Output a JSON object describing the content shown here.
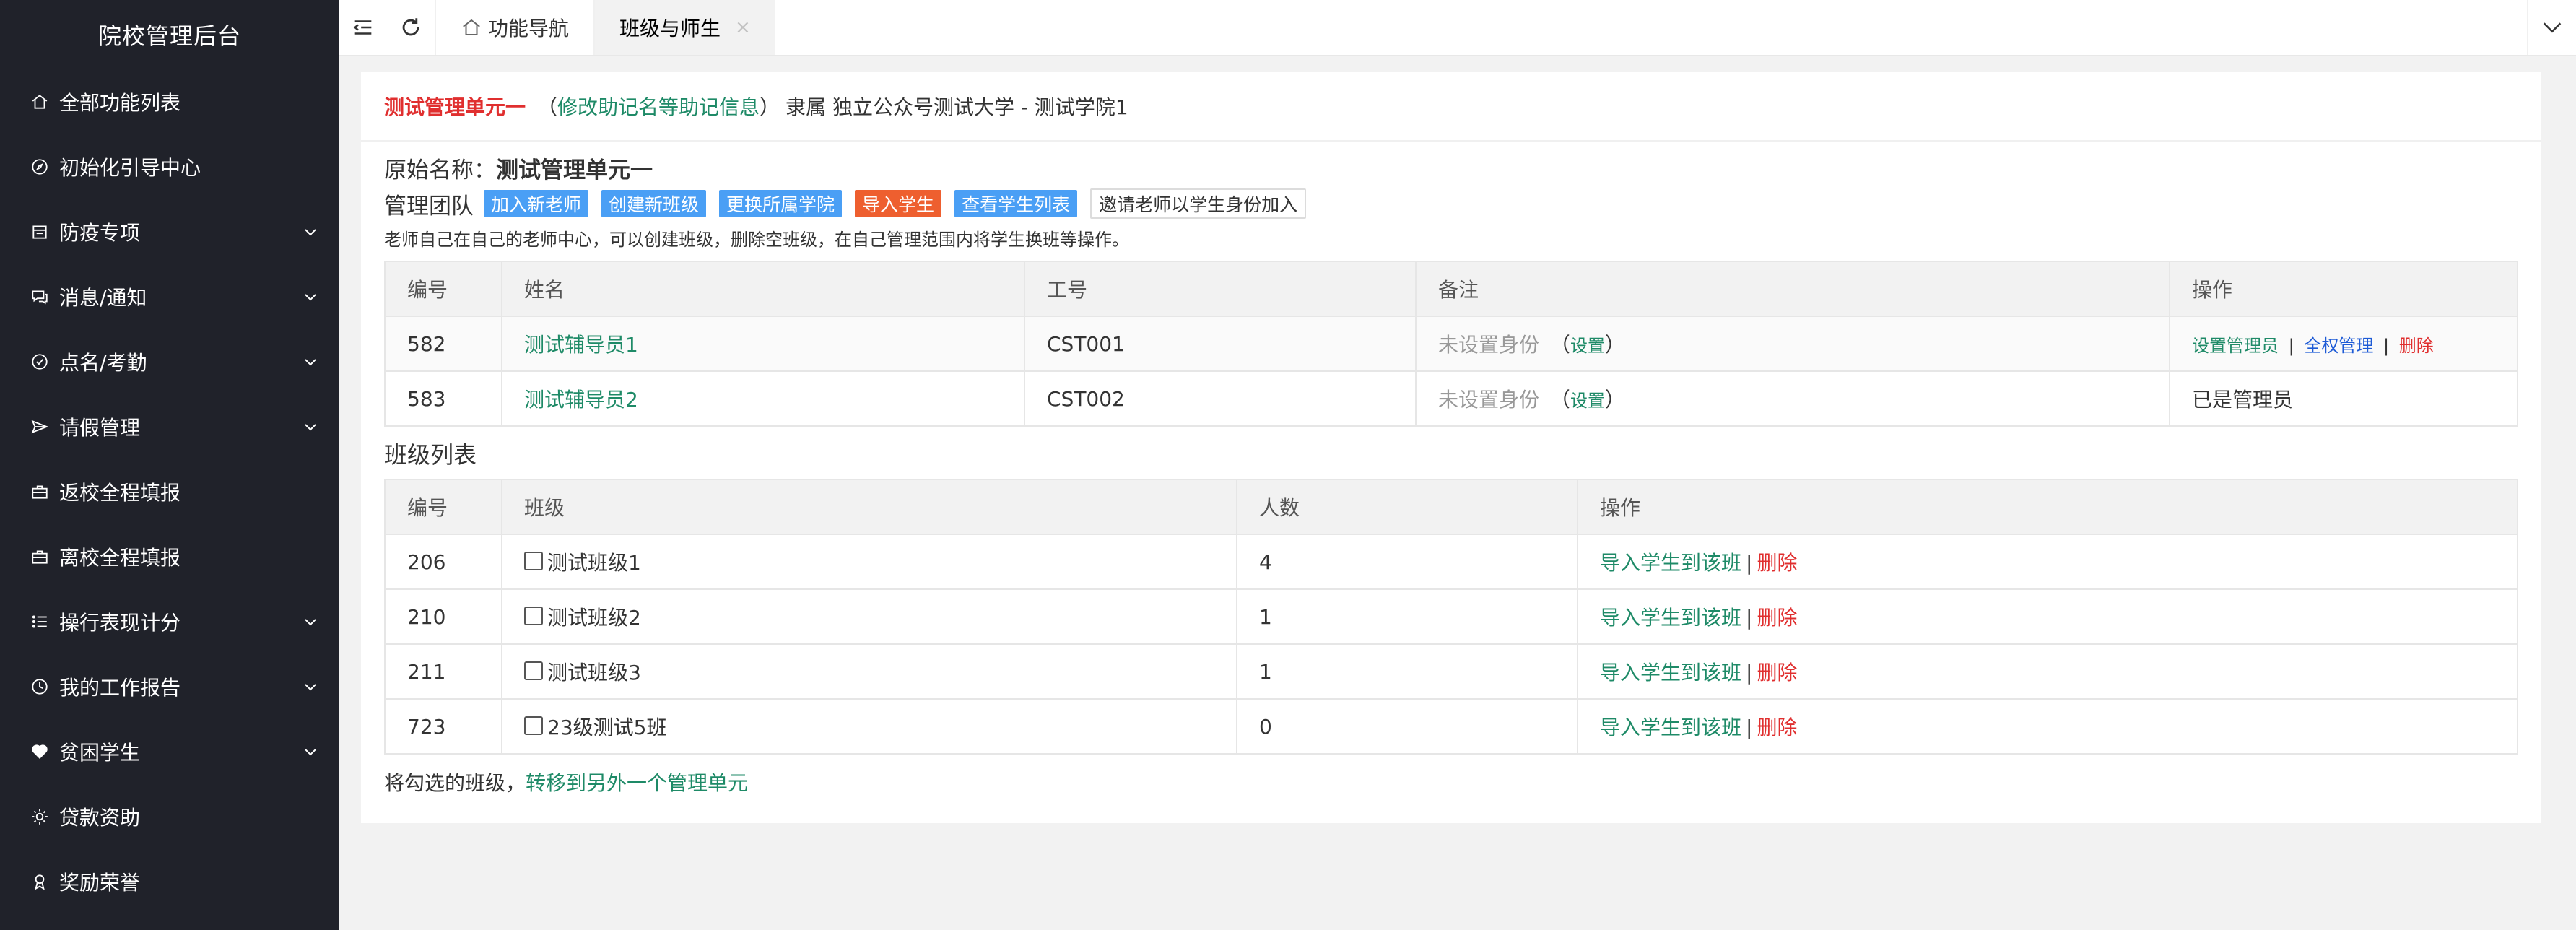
{
  "sidebar": {
    "title": "院校管理后台",
    "items": [
      {
        "label": "全部功能列表",
        "icon": "home-icon",
        "arrow": false
      },
      {
        "label": "初始化引导中心",
        "icon": "compass-icon",
        "arrow": false
      },
      {
        "label": "防疫专项",
        "icon": "calendar-icon",
        "arrow": true
      },
      {
        "label": "消息/通知",
        "icon": "message-icon",
        "arrow": true
      },
      {
        "label": "点名/考勤",
        "icon": "check-circle-icon",
        "arrow": true
      },
      {
        "label": "请假管理",
        "icon": "send-icon",
        "arrow": true
      },
      {
        "label": "返校全程填报",
        "icon": "briefcase-icon",
        "arrow": false
      },
      {
        "label": "离校全程填报",
        "icon": "briefcase-icon",
        "arrow": false
      },
      {
        "label": "操行表现计分",
        "icon": "list-icon",
        "arrow": true
      },
      {
        "label": "我的工作报告",
        "icon": "clock-icon",
        "arrow": true
      },
      {
        "label": "贫困学生",
        "icon": "heart-icon",
        "arrow": true
      },
      {
        "label": "贷款资助",
        "icon": "sun-icon",
        "arrow": false
      },
      {
        "label": "奖励荣誉",
        "icon": "award-icon",
        "arrow": false
      }
    ]
  },
  "topbar": {
    "tabs": [
      {
        "label": "功能导航",
        "active": false
      },
      {
        "label": "班级与师生",
        "active": true
      }
    ],
    "close_symbol": "×"
  },
  "header": {
    "unit_name": "测试管理单元一",
    "paren_open": "（",
    "edit_link": "修改助记名等助记信息",
    "paren_close": "）",
    "belongs": "隶属 独立公众号测试大学 - 测试学院1"
  },
  "info": {
    "original_label": "原始名称：",
    "original_name": "测试管理单元一",
    "team_label": "管理团队",
    "buttons": {
      "add_teacher": "加入新老师",
      "create_class": "创建新班级",
      "change_college": "更换所属学院",
      "import_students": "导入学生",
      "view_students": "查看学生列表",
      "invite_teacher": "邀请老师以学生身份加入"
    },
    "description": "老师自己在自己的老师中心，可以创建班级，删除空班级，在自己管理范围内将学生换班等操作。"
  },
  "teacher_table": {
    "headers": [
      "编号",
      "姓名",
      "工号",
      "备注",
      "操作"
    ],
    "rows": [
      {
        "id": "582",
        "name": "测试辅导员1",
        "code": "CST001",
        "remark": "未设置身份",
        "set": "设置",
        "op_admin": "设置管理员",
        "op_full": "全权管理",
        "op_delete": "删除"
      },
      {
        "id": "583",
        "name": "测试辅导员2",
        "code": "CST002",
        "remark": "未设置身份",
        "set": "设置",
        "op_text": "已是管理员"
      }
    ],
    "open": "（",
    "close": "）",
    "sep": "|"
  },
  "class_section": {
    "title": "班级列表",
    "headers": [
      "编号",
      "班级",
      "人数",
      "操作"
    ],
    "rows": [
      {
        "id": "206",
        "name": "测试班级1",
        "count": "4",
        "op_import": "导入学生到该班",
        "op_delete": "删除"
      },
      {
        "id": "210",
        "name": "测试班级2",
        "count": "1",
        "op_import": "导入学生到该班",
        "op_delete": "删除"
      },
      {
        "id": "211",
        "name": "测试班级3",
        "count": "1",
        "op_import": "导入学生到该班",
        "op_delete": "删除"
      },
      {
        "id": "723",
        "name": "23级测试5班",
        "count": "0",
        "op_import": "导入学生到该班",
        "op_delete": "删除"
      }
    ],
    "sep": "|",
    "footer_text": "将勾选的班级，",
    "footer_link": "转移到另外一个管理单元"
  },
  "colors": {
    "sidebar_bg": "#20222a",
    "link_green": "#1e8a67",
    "danger_red": "#e02f2f",
    "tag_blue": "#4a9ff5",
    "tag_orange": "#ee5f2f"
  }
}
